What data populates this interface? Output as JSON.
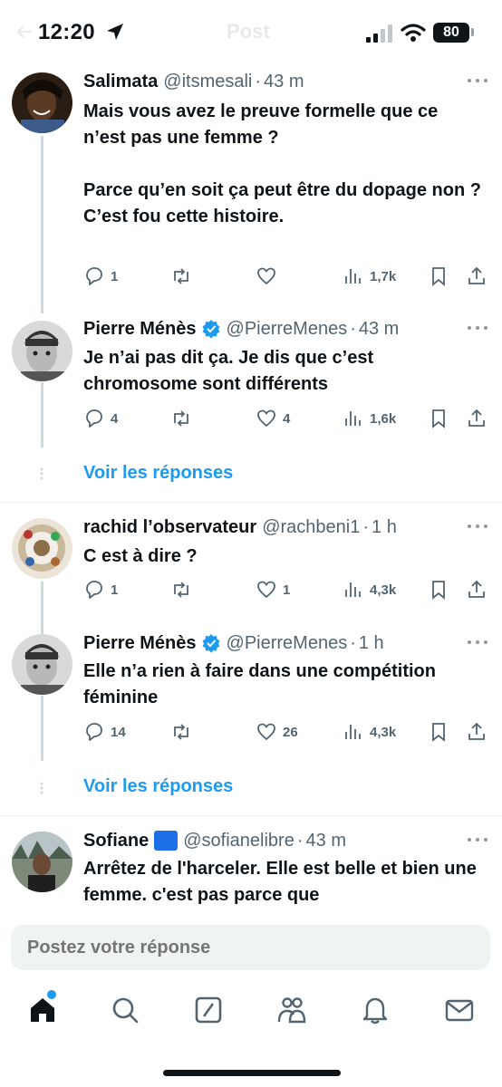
{
  "status_bar": {
    "time": "12:20",
    "battery": "80",
    "ghost_title": "Post"
  },
  "tweets": [
    {
      "name": "Salimata",
      "handle": "@itsmesali",
      "time": "43 m",
      "verified": false,
      "text": "Mais vous avez le preuve formelle que ce n’est pas une femme ?\n\nParce qu’en soit ça peut être du dopage non ?\nC’est fou cette histoire.",
      "replies": "1",
      "reposts": "",
      "likes": "",
      "views": "1,7k"
    },
    {
      "name": "Pierre Ménès",
      "handle": "@PierreMenes",
      "time": "43 m",
      "verified": true,
      "text": "Je n’ai pas dit ça. Je dis que c’est chromosome sont différents",
      "replies": "4",
      "reposts": "",
      "likes": "4",
      "views": "1,6k"
    },
    {
      "name": "rachid l’observateur",
      "handle": "@rachbeni1",
      "time": "1 h",
      "verified": false,
      "text": "C est à dire ?",
      "replies": "1",
      "reposts": "",
      "likes": "1",
      "views": "4,3k"
    },
    {
      "name": "Pierre Ménès",
      "handle": "@PierreMenes",
      "time": "1 h",
      "verified": true,
      "text": "Elle n’a rien à faire dans une compétition féminine",
      "replies": "14",
      "reposts": "",
      "likes": "26",
      "views": "4,3k"
    },
    {
      "name": "Sofiane",
      "handle": "@sofianelibre",
      "time": "43 m",
      "verified": false,
      "text": "Arrêtez de l'harceler. Elle est belle et bien une femme. c'est pas parce que"
    }
  ],
  "show_replies_label": "Voir les réponses",
  "reply_box": {
    "placeholder": "Postez votre réponse"
  },
  "nav": [
    "home-icon",
    "search-icon",
    "grok-icon",
    "communities-icon",
    "notifications-icon",
    "messages-icon"
  ],
  "colors": {
    "accent": "#1d9bf0",
    "text": "#0f1419",
    "secondary": "#536471"
  }
}
